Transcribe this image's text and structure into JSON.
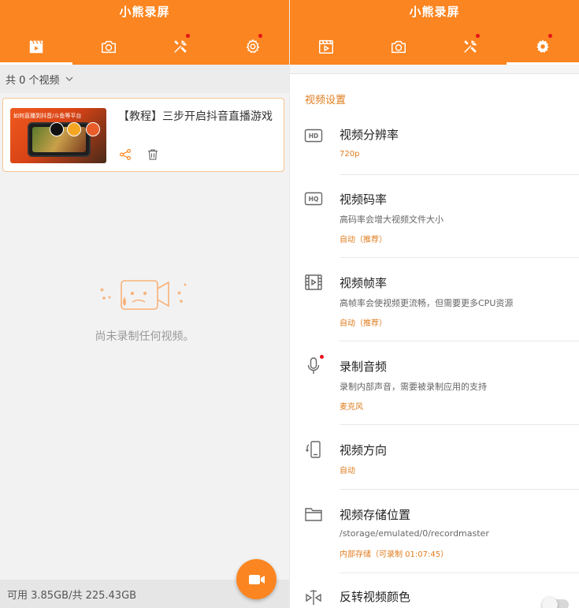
{
  "left": {
    "app_title": "小熊录屏",
    "tabs": [
      {
        "icon": "video-clapper-icon",
        "active": true,
        "dot": false
      },
      {
        "icon": "camera-icon",
        "active": false,
        "dot": false
      },
      {
        "icon": "tools-icon",
        "active": false,
        "dot": true
      },
      {
        "icon": "gear-icon",
        "active": false,
        "dot": true
      }
    ],
    "count_label": "共 0 个视频",
    "video": {
      "title": "【教程】三步开启抖音直播游戏",
      "thumb_text": "如何直播到抖音/斗鱼等平台"
    },
    "empty_text": "尚未录制任何视频。",
    "storage_text": "可用 3.85GB/共 225.43GB"
  },
  "right": {
    "app_title": "小熊录屏",
    "tabs": [
      {
        "icon": "video-clapper-icon",
        "active": false,
        "dot": false
      },
      {
        "icon": "camera-icon",
        "active": false,
        "dot": false
      },
      {
        "icon": "tools-icon",
        "active": false,
        "dot": true
      },
      {
        "icon": "gear-icon",
        "active": true,
        "dot": true
      }
    ],
    "section_title": "视频设置",
    "settings": {
      "resolution": {
        "name": "视频分辨率",
        "value": "720p",
        "icon": "hd-icon"
      },
      "bitrate": {
        "name": "视频码率",
        "desc": "高码率会增大视频文件大小",
        "value": "自动（推荐）",
        "icon": "hq-icon"
      },
      "framerate": {
        "name": "视频帧率",
        "desc": "高帧率会使视频更流畅，但需要更多CPU资源",
        "value": "自动（推荐）",
        "icon": "film-icon"
      },
      "audio": {
        "name": "录制音频",
        "desc": "录制内部声音，需要被录制应用的支持",
        "value": "麦克风",
        "icon": "microphone-icon"
      },
      "orientation": {
        "name": "视频方向",
        "value": "自动",
        "icon": "rotate-phone-icon"
      },
      "storage": {
        "name": "视频存储位置",
        "desc": "/storage/emulated/0/recordmaster",
        "value": "内部存储（可录制 01:07:45）",
        "icon": "folder-icon"
      },
      "invert": {
        "name": "反转视频颜色",
        "icon": "invert-color-icon",
        "enabled": false
      }
    }
  },
  "colors": {
    "accent": "#fb8520",
    "accent_text": "#e07c1e",
    "badge_red": "#e8121c"
  }
}
